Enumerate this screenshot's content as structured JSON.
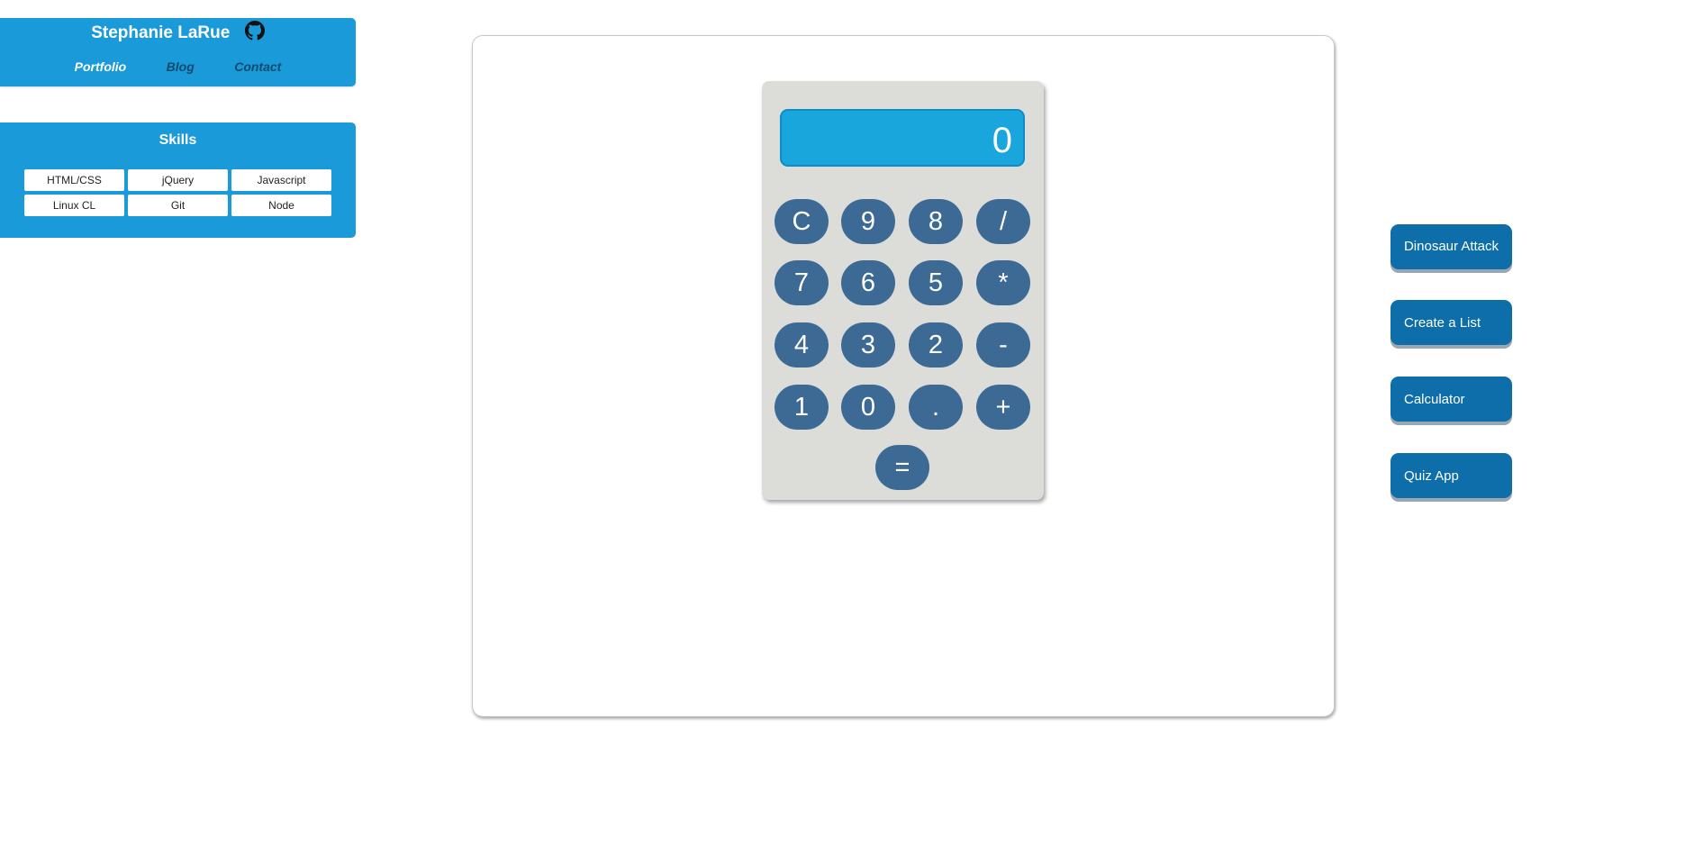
{
  "header": {
    "title": "Stephanie LaRue",
    "github_icon": "github-icon",
    "nav": [
      "Portfolio",
      "Blog",
      "Contact"
    ]
  },
  "skills": {
    "title": "Skills",
    "items": [
      "HTML/CSS",
      "jQuery",
      "Javascript",
      "Linux CL",
      "Git",
      "Node"
    ]
  },
  "calculator": {
    "display": "0",
    "keys": [
      "C",
      "9",
      "8",
      "/",
      "7",
      "6",
      "5",
      "*",
      "4",
      "3",
      "2",
      "-",
      "1",
      "0",
      ".",
      "+",
      "="
    ]
  },
  "projects": {
    "items": [
      "Dinosaur Attack",
      "Create a List",
      "Calculator",
      "Quiz App"
    ]
  },
  "colors": {
    "panel_blue": "#1a9ad9",
    "display_blue": "#19a6dc",
    "key_blue": "#3c6a94",
    "project_blue": "#0d6ea9",
    "calculator_body": "#dcdcd8"
  }
}
